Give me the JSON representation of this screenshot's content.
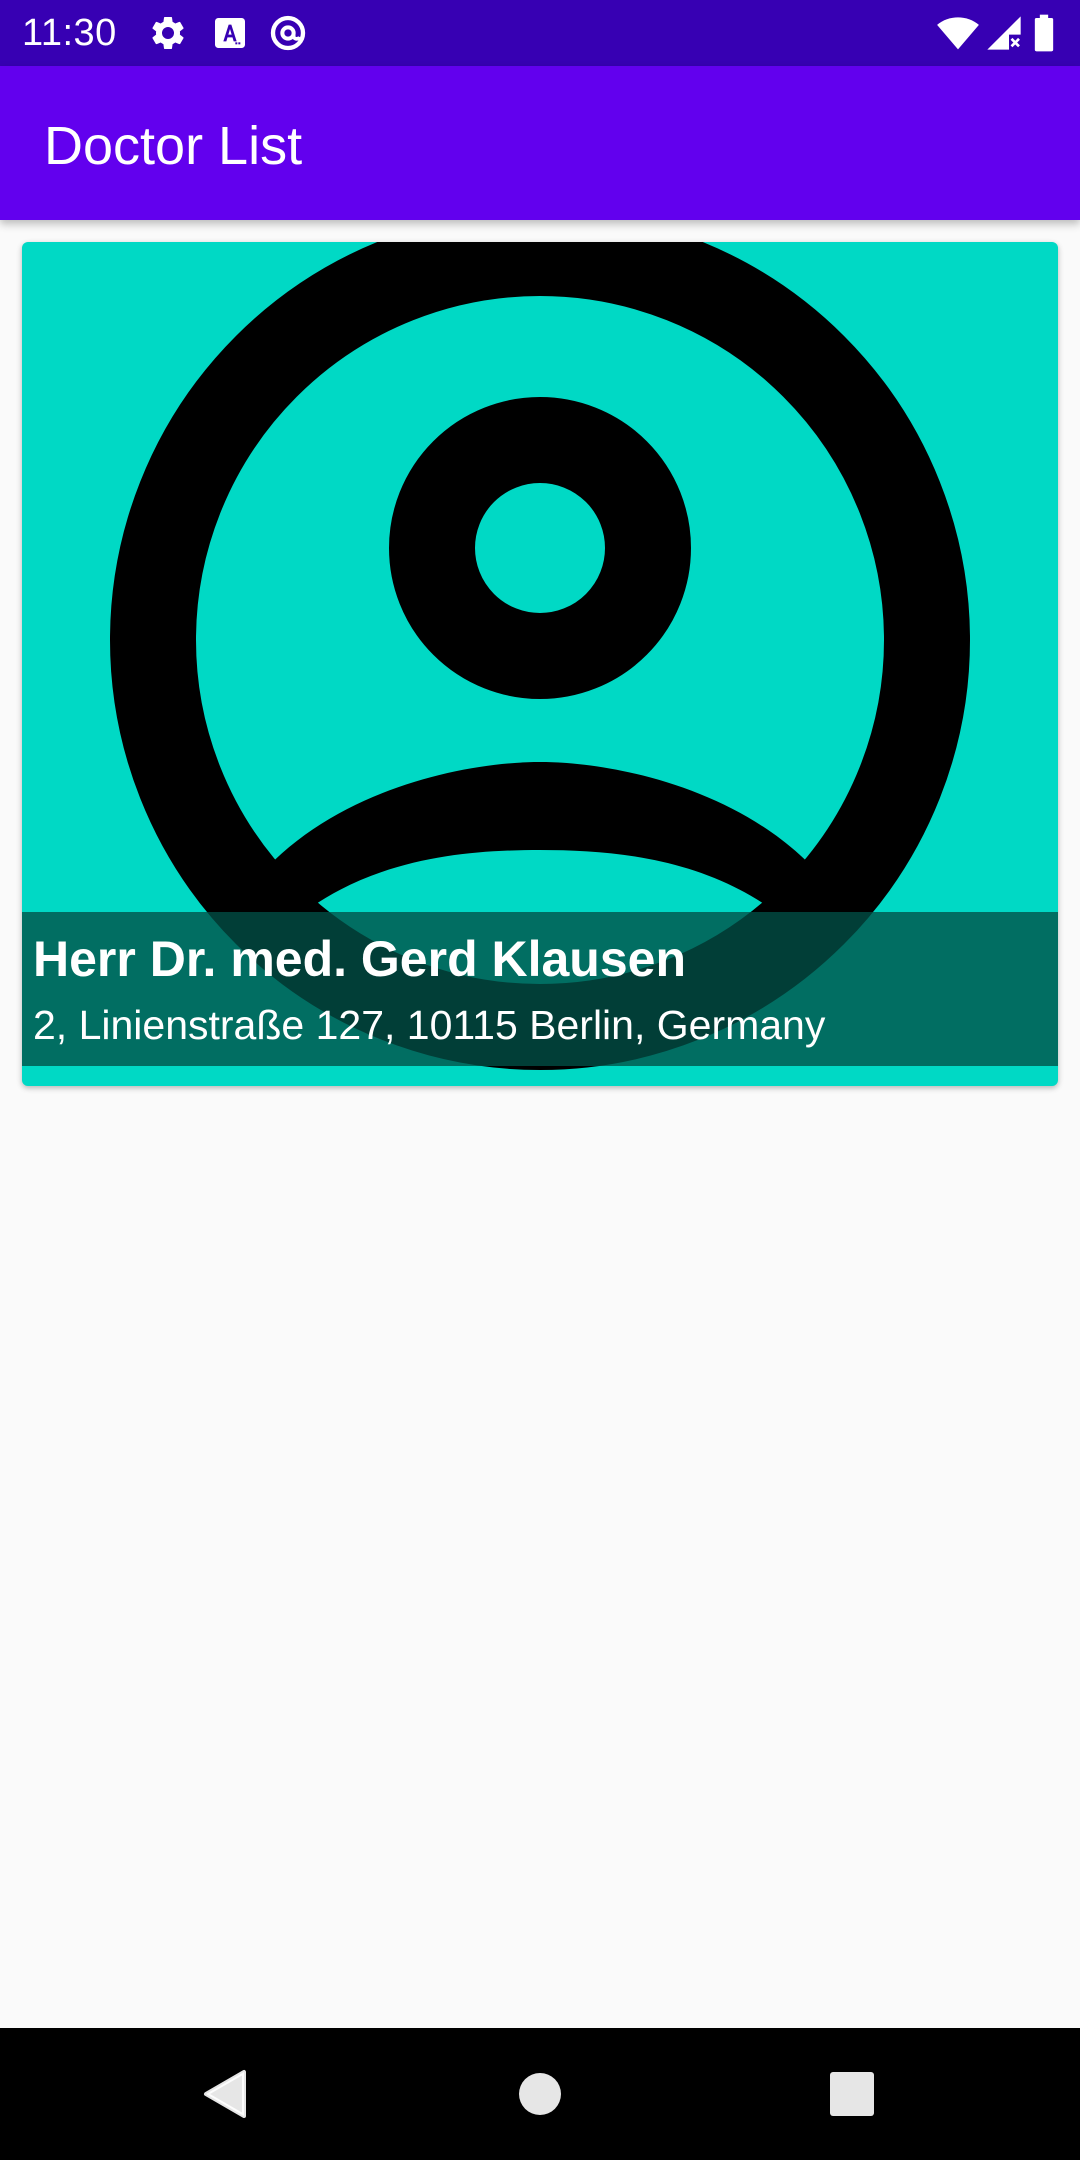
{
  "status_bar": {
    "time": "11:30",
    "icons_left": [
      "settings-icon",
      "keyboard-a-icon",
      "sync-at-icon"
    ],
    "icons_right": [
      "wifi-icon",
      "cellular-signal-icon",
      "battery-icon"
    ]
  },
  "app_bar": {
    "title": "Doctor List"
  },
  "doctors": [
    {
      "name": "Herr Dr. med. Gerd Klausen",
      "address": "2, Linienstraße 127, 10115 Berlin, Germany",
      "image": "account-circle-icon"
    }
  ],
  "nav_bar": {
    "buttons": [
      "back-icon",
      "home-icon",
      "recents-icon"
    ]
  },
  "colors": {
    "status_bar": "#3700B3",
    "app_bar": "#6200EE",
    "card_background": "#00D9C5",
    "caption_overlay": "#015046",
    "background": "#FAFAFA"
  }
}
